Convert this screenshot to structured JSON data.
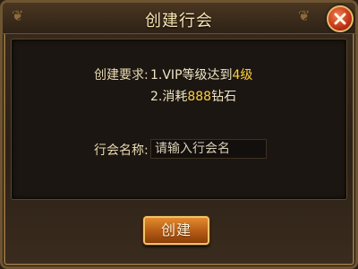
{
  "dialog": {
    "title": "创建行会",
    "close_icon": "close-x-icon"
  },
  "requirements": {
    "label": "创建要求:",
    "line1_prefix": "1.VIP等级达到",
    "line1_value": "4级",
    "line2_prefix": "2.消耗",
    "line2_value": "888",
    "line2_suffix": "钻石"
  },
  "guild_name": {
    "label": "行会名称:",
    "placeholder": "请输入行会名",
    "value": ""
  },
  "create_button": {
    "label": "创建"
  },
  "colors": {
    "highlight": "#ffcf3a",
    "text": "#efe4c4",
    "button": "#c8681c",
    "close": "#c23218"
  }
}
